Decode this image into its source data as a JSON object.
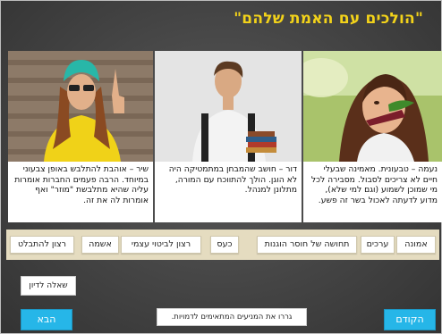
{
  "title": "\"הולכים עם האמת שלהם\"",
  "cards": [
    {
      "image": "girl-eating-salad",
      "description": "נעמה – טבעונית. מאמינה שבעלי חיים לא צריכים לסבול. מסבירה לכל מי שמוכן לשמוע (וגם למי שלא), מדוע לדעתה לאכול בשר זה פשע."
    },
    {
      "image": "student-with-books",
      "description": "דור – חושב שהמבחן במתמטיקה היה לא הוגן. הולך להתווכח עם המורה, מתלונן למנהל."
    },
    {
      "image": "girl-with-sunglasses",
      "description": "שיר – אוהבת להתלבש באופן צבעוני במיוחד. הרבה פעמים החברות אומרות עליה שהיא מתלבשת \"מוזר\" ואף אומרות לה את זה."
    }
  ],
  "chips": [
    "אמונה",
    "ערכים",
    "תחושה של חוסר הוגנות",
    "כעס",
    "רצון לביטוי עצמי",
    "אשמה",
    "רצון להתבלט"
  ],
  "question_button": "שאלה לדיון",
  "instruction": "גררו את המניעים המתאימים לדמויות.",
  "prev_button": "הקודם",
  "next_button": "הבא",
  "colors": {
    "title": "#f2d21a",
    "strip": "#e5dcc0",
    "nav": "#26b6e8"
  }
}
